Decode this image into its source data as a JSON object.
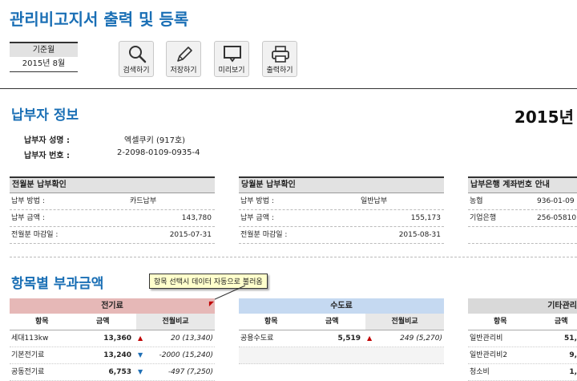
{
  "title": "관리비고지서 출력 및 등록",
  "base_month": {
    "label": "기준월",
    "value": "2015년 8월"
  },
  "toolbar": [
    {
      "label": "검색하기",
      "icon": "search-icon"
    },
    {
      "label": "저장하기",
      "icon": "pencil-icon"
    },
    {
      "label": "미리보기",
      "icon": "monitor-icon"
    },
    {
      "label": "출력하기",
      "icon": "printer-icon"
    }
  ],
  "payer": {
    "section_title": "납부자 정보",
    "year": "2015년",
    "name_label": "납부자 성명 :",
    "name_value": "엑셀쿠키 (917호)",
    "number_label": "납부자 번호 :",
    "number_value": "2-2098-0109-0935-4"
  },
  "prev_payment": {
    "title": "전월분 납부확인",
    "rows": [
      {
        "label": "납부 방법 :",
        "value": "카드납부"
      },
      {
        "label": "납부 금액 :",
        "value": "143,780"
      },
      {
        "label": "전월분 마감일 :",
        "value": "2015-07-31"
      }
    ]
  },
  "curr_payment": {
    "title": "당월분 납부확인",
    "rows": [
      {
        "label": "납부 방법 :",
        "value": "일반납부"
      },
      {
        "label": "납부 금액 :",
        "value": "155,173"
      },
      {
        "label": "전월분 마감일 :",
        "value": "2015-08-31"
      }
    ]
  },
  "bank_info": {
    "title": "납부은행 계좌번호 안내",
    "rows": [
      {
        "bank": "농협",
        "account": "936-01-09"
      },
      {
        "bank": "기업은행",
        "account": "256-05810"
      }
    ]
  },
  "charges": {
    "section_title": "항목별 부과금액",
    "callout": "항목 선택시 데이터 자동으로 불러옴",
    "col_item": "항목",
    "col_amount": "금액",
    "col_compare": "전월비교",
    "electric": {
      "title": "전기료",
      "color": "#e6b8b7",
      "rows": [
        {
          "item": "세대113kw",
          "amount": "13,360",
          "dir": "up",
          "compare": "20 (13,340)"
        },
        {
          "item": "기본전기료",
          "amount": "13,240",
          "dir": "down",
          "compare": "-2000 (15,240)"
        },
        {
          "item": "공동전기료",
          "amount": "6,753",
          "dir": "down",
          "compare": "-497 (7,250)"
        }
      ]
    },
    "water": {
      "title": "수도료",
      "color": "#c5d9f1",
      "rows": [
        {
          "item": "공용수도료",
          "amount": "5,519",
          "dir": "up",
          "compare": "249 (5,270)"
        }
      ]
    },
    "other": {
      "title": "기타관리",
      "color": "#d9d9d9",
      "rows": [
        {
          "item": "일반관리비",
          "amount": "51,"
        },
        {
          "item": "일반관리비2",
          "amount": "9,"
        },
        {
          "item": "청소비",
          "amount": "1,"
        }
      ]
    }
  },
  "colors": {
    "title_blue": "#1a6fb5",
    "up": "#c00000",
    "down": "#1f6fb5"
  }
}
